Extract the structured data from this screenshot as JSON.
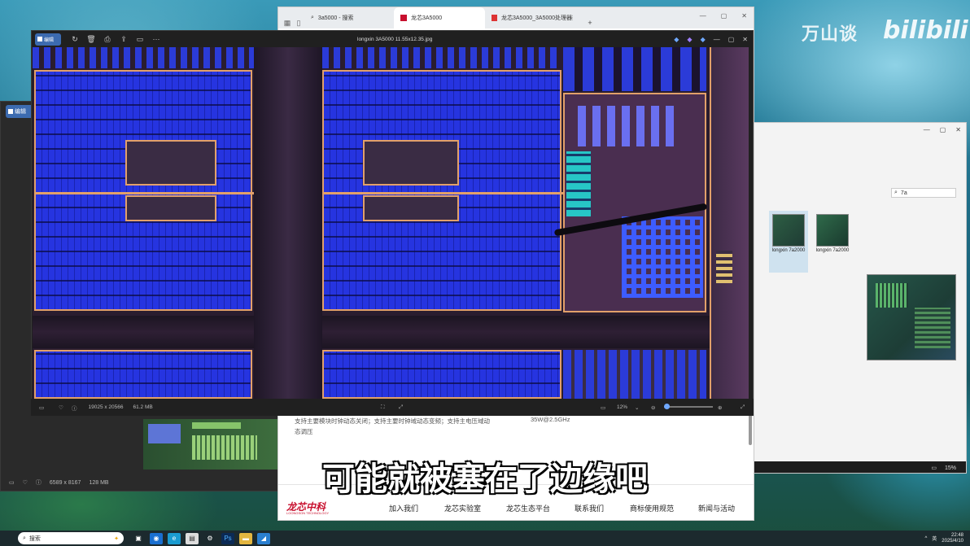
{
  "watermark": {
    "author": "万山谈",
    "logo": "bilibili"
  },
  "browser": {
    "tabs": [
      {
        "label": "3a5000 - 搜索",
        "active": false
      },
      {
        "label": "龙芯3A5000",
        "active": true
      },
      {
        "label": "龙芯3A5000_3A5000处理器数据…",
        "active": false
      }
    ],
    "new_tab": "+",
    "content": {
      "feature_text": "支持主要模块时钟动态关闭；支持主要时钟域动态变频；支持主电压域动态调压",
      "spec_value": "35W@2.5GHz"
    },
    "footer": {
      "brand": "龙芯中科",
      "brand_sub": "LOONGSON TECHNOLOGY",
      "links": [
        "加入我们",
        "龙芯实验室",
        "龙芯生态平台",
        "联系我们",
        "商标使用规范",
        "新闻与活动"
      ]
    }
  },
  "photos_main": {
    "edit_label": "编辑",
    "title": "longxin 3A5000 11.55x12.35.jpg",
    "dimensions": "19025 x 20566",
    "filesize": "61.2 MB",
    "zoom": "12%"
  },
  "photos_back": {
    "edit_label": "编辑",
    "dimensions": "6589 x 8167",
    "filesize": "128 MB"
  },
  "explorer": {
    "search_value": "7a",
    "files": [
      {
        "name": "longxin 7a2000",
        "selected": true
      },
      {
        "name": "longxin 7a2000",
        "selected": false
      }
    ],
    "zoom": "15%"
  },
  "subtitle": "可能就被塞在了边缘吧",
  "taskbar": {
    "search_placeholder": "搜索",
    "time": "22:48",
    "date": "2025/4/10",
    "lang": "英"
  }
}
